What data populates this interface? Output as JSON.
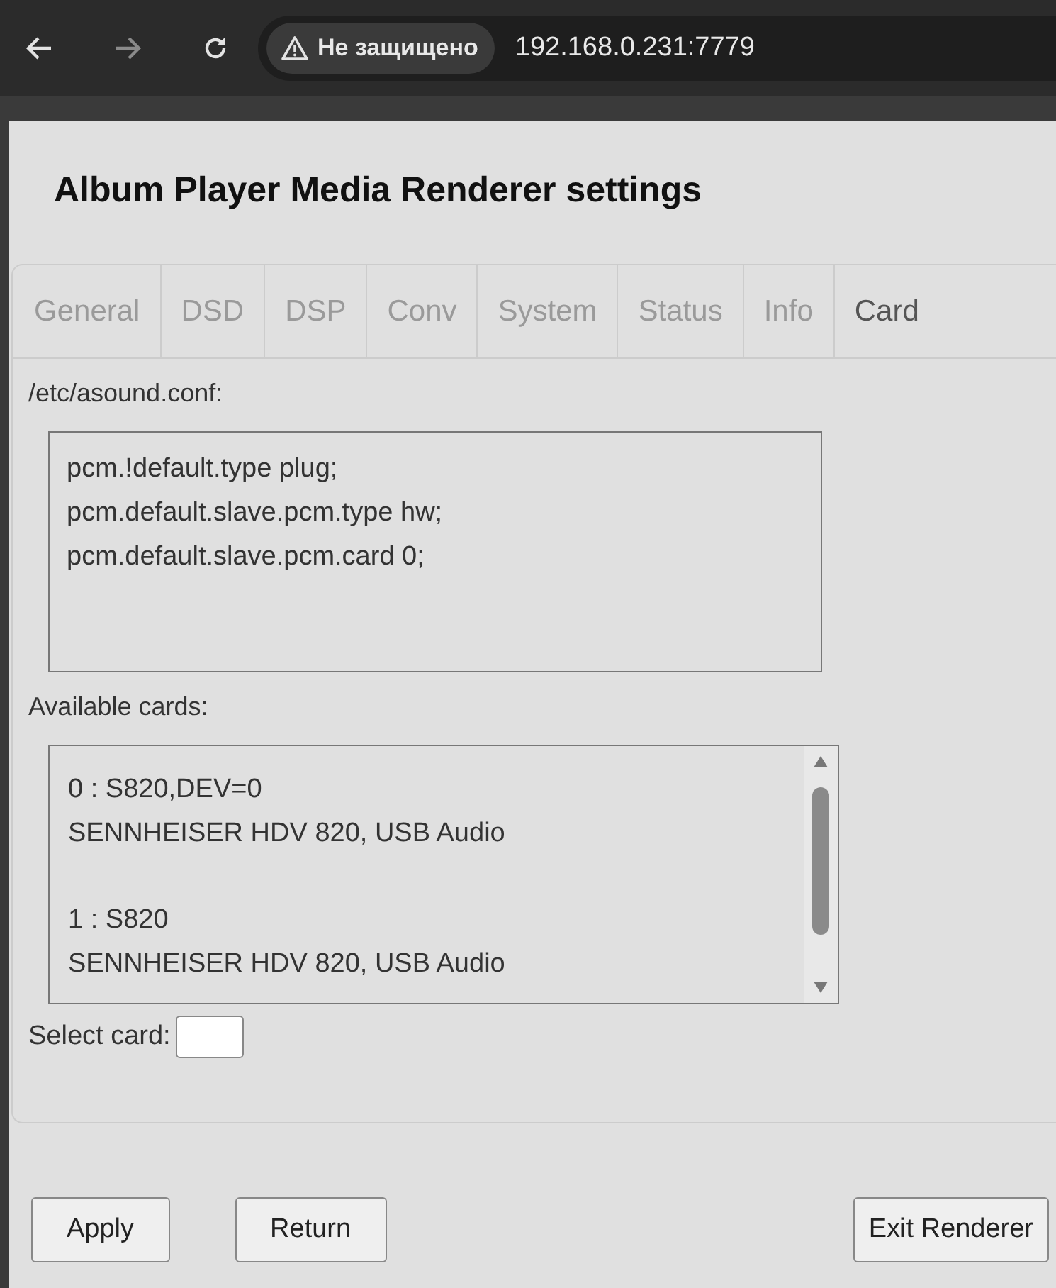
{
  "browser": {
    "security_label": "Не защищено",
    "url": "192.168.0.231:7779"
  },
  "title": "Album Player Media Renderer settings",
  "tabs": [
    {
      "label": "General",
      "selected": false
    },
    {
      "label": "DSD",
      "selected": false
    },
    {
      "label": "DSP",
      "selected": false
    },
    {
      "label": "Conv",
      "selected": false
    },
    {
      "label": "System",
      "selected": false
    },
    {
      "label": "Status",
      "selected": false
    },
    {
      "label": "Info",
      "selected": false
    },
    {
      "label": "Card",
      "selected": true
    }
  ],
  "config": {
    "label": "/etc/asound.conf:",
    "lines": [
      "pcm.!default.type plug;",
      "pcm.default.slave.pcm.type hw;",
      "pcm.default.slave.pcm.card 0;"
    ]
  },
  "cards": {
    "label": "Available cards:",
    "items": [
      {
        "id": "0 : S820,DEV=0",
        "name": "SENNHEISER HDV 820, USB Audio"
      },
      {
        "id": "1 : S820",
        "name": "SENNHEISER HDV 820, USB Audio"
      }
    ]
  },
  "select_card": {
    "label": "Select card:"
  },
  "buttons": [
    {
      "label": "Apply",
      "kind": "left"
    },
    {
      "label": "Return",
      "kind": "left"
    },
    {
      "label": "Exit Renderer",
      "kind": "right"
    }
  ]
}
